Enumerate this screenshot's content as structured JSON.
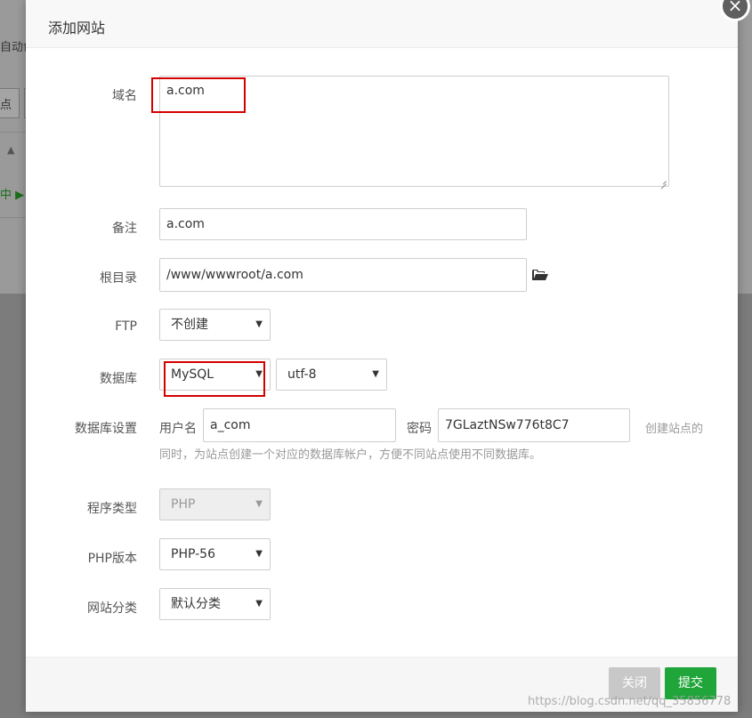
{
  "background": {
    "auto_text": "自动创",
    "btn_text": "点",
    "sort_icon": "triangle-up-icon",
    "status_text": "中 ▶"
  },
  "dialog": {
    "title": "添加网站",
    "close_icon": "×",
    "fields": {
      "domain_label": "域名",
      "domain_value": "a.com",
      "remark_label": "备注",
      "remark_value": "a.com",
      "root_label": "根目录",
      "root_value": "/www/wwwroot/a.com",
      "ftp_label": "FTP",
      "ftp_value": "不创建",
      "db_label": "数据库",
      "db_value": "MySQL",
      "db_charset": "utf-8",
      "db_settings_label": "数据库设置",
      "db_user_label": "用户名",
      "db_user_value": "a_com",
      "db_pass_label": "密码",
      "db_pass_value": "7GLaztNSw776t8C7",
      "db_hint_line1": "创建站点的",
      "db_hint_line2": "同时，为站点创建一个对应的数据库帐户，方便不同站点使用不同数据库。",
      "program_label": "程序类型",
      "program_value": "PHP",
      "php_label": "PHP版本",
      "php_value": "PHP-56",
      "category_label": "网站分类",
      "category_value": "默认分类"
    },
    "footer": {
      "close_label": "关闭",
      "submit_label": "提交"
    }
  },
  "watermark": "https://blog.csdn.net/qq_35856778",
  "colors": {
    "accent": "#20a53a",
    "highlight": "#d40000"
  }
}
